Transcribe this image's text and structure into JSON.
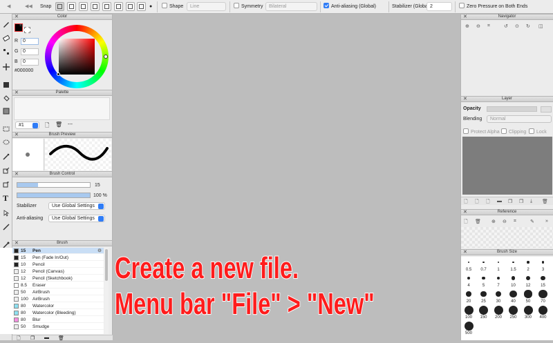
{
  "toolbar": {
    "snap_label": "Snap",
    "shape_label": "Shape",
    "shape_value": "Line",
    "symmetry_label": "Symmetry",
    "symmetry_value": "Bilateral",
    "antialias_label": "Anti-aliasing (Global)",
    "stabilizer_label": "Stabilizer (Global)",
    "stabilizer_value": "2",
    "zero_pressure_label": "Zero Pressure on Both Ends"
  },
  "color_panel": {
    "title": "Color",
    "r_label": "R",
    "r_value": "0",
    "g_label": "G",
    "g_value": "0",
    "b_label": "B",
    "b_value": "0",
    "hex_value": "#000000",
    "current_color": "#000000"
  },
  "palette_panel": {
    "title": "Palette",
    "selector_value": "#1",
    "more": "---"
  },
  "brush_preview_panel": {
    "title": "Brush Preview"
  },
  "brush_control_panel": {
    "title": "Brush Control",
    "size_value": "15",
    "size_fraction": 0.29,
    "opacity_value": "100 %",
    "opacity_fraction": 1.0,
    "stabilizer_label": "Stabilizer",
    "stabilizer_value": "Use Global Settings",
    "antialias_label": "Anti-aliasing",
    "antialias_value": "Use Global Settings"
  },
  "brush_panel": {
    "title": "Brush",
    "items": [
      {
        "size": "15",
        "name": "Pen",
        "color": "#222222"
      },
      {
        "size": "15",
        "name": "Pen (Fade In/Out)",
        "color": "#222222"
      },
      {
        "size": "10",
        "name": "Pencil",
        "color": "#222222"
      },
      {
        "size": "12",
        "name": "Pencil (Canvas)",
        "color": "#eeeeee"
      },
      {
        "size": "12",
        "name": "Pencil (Sketchbook)",
        "color": "#eeeeee"
      },
      {
        "size": "8.5",
        "name": "Eraser",
        "color": "#ffffff"
      },
      {
        "size": "50",
        "name": "AirBrush",
        "color": "#eeeeee"
      },
      {
        "size": "100",
        "name": "AirBrush",
        "color": "#eeeeee"
      },
      {
        "size": "80",
        "name": "Watercolor",
        "color": "#8ee0f0"
      },
      {
        "size": "80",
        "name": "Watercolor (Bleeding)",
        "color": "#8ee0f0"
      },
      {
        "size": "80",
        "name": "Blur",
        "color": "#f58ee0"
      },
      {
        "size": "50",
        "name": "Smudge",
        "color": "#eeeeee"
      }
    ]
  },
  "navigator_panel": {
    "title": "Navigator"
  },
  "layer_panel": {
    "title": "Layer",
    "opacity_label": "Opacity",
    "blending_label": "Blending",
    "blending_value": "Normal",
    "protect_alpha_label": "Protect Alpha",
    "clipping_label": "Clipping",
    "lock_label": "Lock"
  },
  "reference_panel": {
    "title": "Reference"
  },
  "brush_size_panel": {
    "title": "Brush Size",
    "sizes": [
      "0.5",
      "0.7",
      "1",
      "1.5",
      "2",
      "3",
      "4",
      "5",
      "7",
      "10",
      "12",
      "15",
      "20",
      "25",
      "30",
      "40",
      "50",
      "70",
      "100",
      "150",
      "200",
      "250",
      "300",
      "400",
      "500"
    ]
  },
  "overlay": {
    "line1": "Create a new file.",
    "line2": "Menu bar \"File\" > \"New\""
  }
}
